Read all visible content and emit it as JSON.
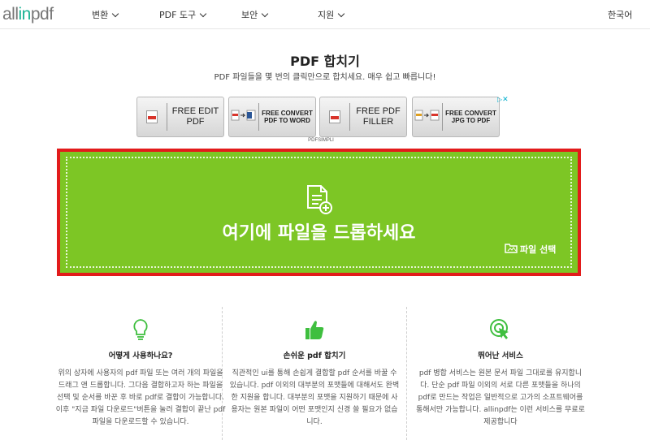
{
  "header": {
    "logo_left": "all",
    "logo_accent": "in",
    "logo_right": "pdf",
    "nav": [
      "변환",
      "PDF 도구",
      "보안",
      "지원"
    ],
    "language": "한국어"
  },
  "hero": {
    "title": "PDF 합치기",
    "subtitle": "PDF 파일들을 몇 번의 클릭만으로 합치세요. 매우 쉽고 빠릅니다!"
  },
  "ads": {
    "items": [
      "FREE EDIT PDF",
      "FREE CONVERT PDF TO WORD",
      "FREE PDF FILLER",
      "FREE CONVERT JPG TO PDF"
    ],
    "source": "PDFSIMPLI",
    "choices": "✕"
  },
  "dropzone": {
    "text": "여기에 파일을 드롭하세요",
    "choose_label": "파일 선택",
    "bg_color": "#7dc625",
    "border_color": "#e21b1b"
  },
  "features": [
    {
      "icon": "lightbulb-icon",
      "title": "어떻게 사용하나요?",
      "text": "위의 상자에 사용자의 pdf 파일 또는 여러 개의 파일을 드래그 앤 드롭합니다. 그다음 결합하고자 하는 파일을 선택 및 순서를 바꾼 후 바로 pdf로 결합이 가능합니다. 이후 \"지금 파일 다운로드\"버튼을 눌러 결합이 끝난 pdf 파일을 다운로드할 수 있습니다."
    },
    {
      "icon": "thumbs-up-icon",
      "title": "손쉬운 pdf 합치기",
      "text": "직관적인 ui를 통해 손쉽게 결합할 pdf 순서를 바꿀 수 있습니다. pdf 이외의 대부분의 포맷들에 대해서도 완벽한 지원을 합니다. 대부분의 포맷을 지원하기 때문에 사용자는 원본 파일이 어떤 포맷인지 신경 쓸 필요가 없습니다."
    },
    {
      "icon": "target-click-icon",
      "title": "뛰어난 서비스",
      "text": "pdf 병합 서비스는 원본 문서 파일 그대로를 유지합니다. 단순 pdf 파일 이외의 서로 다른 포맷들을 하나의 pdf로 만드는 작업은 일반적으로 고가의 소프트웨어를 통해서만 가능합니다. allinpdf는 이런 서비스를 무료로 제공합니다"
    }
  ],
  "colors": {
    "accent": "#1ab394",
    "feature_icon": "#3fbf3f"
  }
}
